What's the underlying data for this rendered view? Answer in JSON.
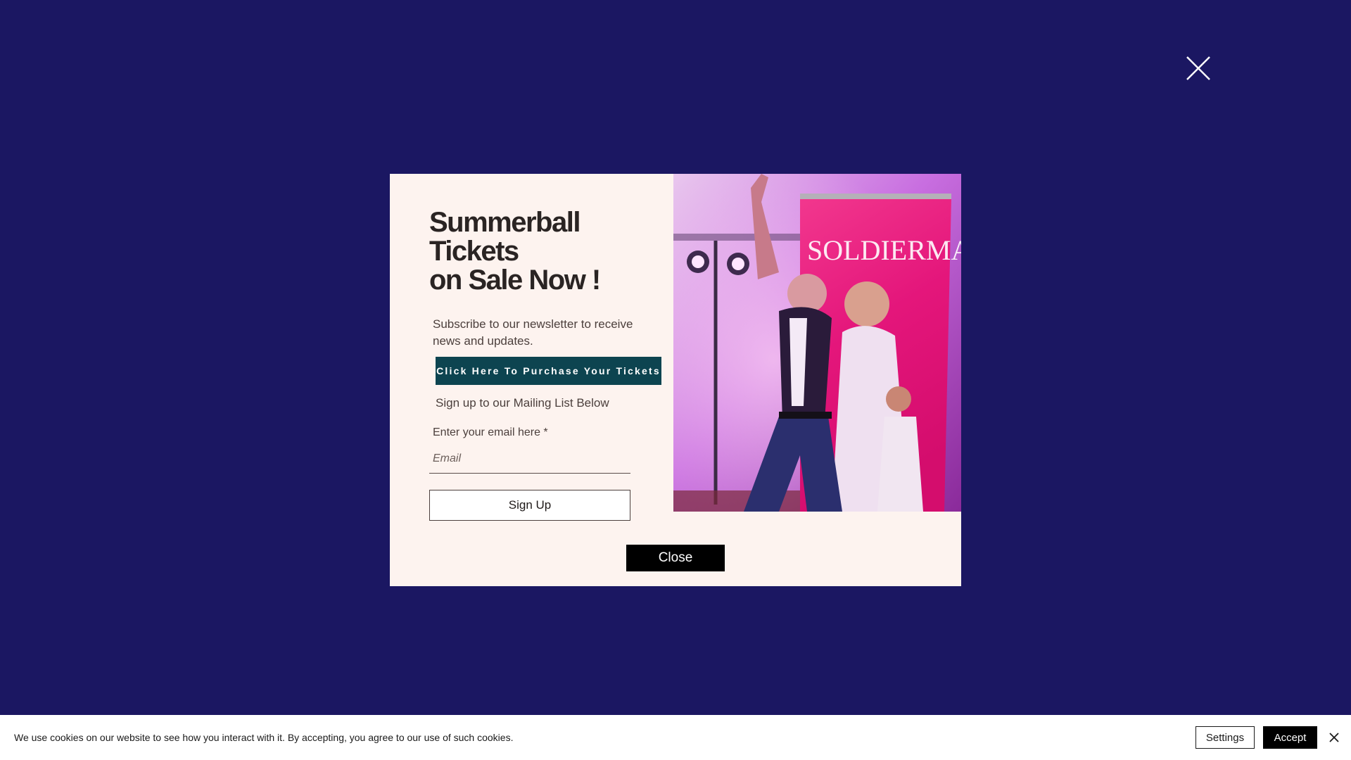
{
  "overlay": {
    "close_icon": "close-x-icon",
    "background_color": "#1b1762"
  },
  "modal": {
    "headline_lines": [
      "Summerball",
      "Tickets",
      "on Sale Now !"
    ],
    "subscribe_text": "Subscribe to our newsletter to receive news and updates.",
    "tickets_button_label": "Click Here To Purchase Your Tickets",
    "mailing_text": "Sign up to our Mailing List Below",
    "email_label": "Enter your email here *",
    "email_placeholder": "Email",
    "email_value": "",
    "signup_label": "Sign Up",
    "close_label": "Close",
    "image_banner_text": "SOLDIERMAC",
    "background_color": "#fdf3ef",
    "button_color": "#0d4450"
  },
  "cookie_bar": {
    "text": "We use cookies on our website to see how you interact with it. By accepting, you agree to our use of such cookies.",
    "settings_label": "Settings",
    "accept_label": "Accept",
    "close_icon": "close-x-icon"
  }
}
